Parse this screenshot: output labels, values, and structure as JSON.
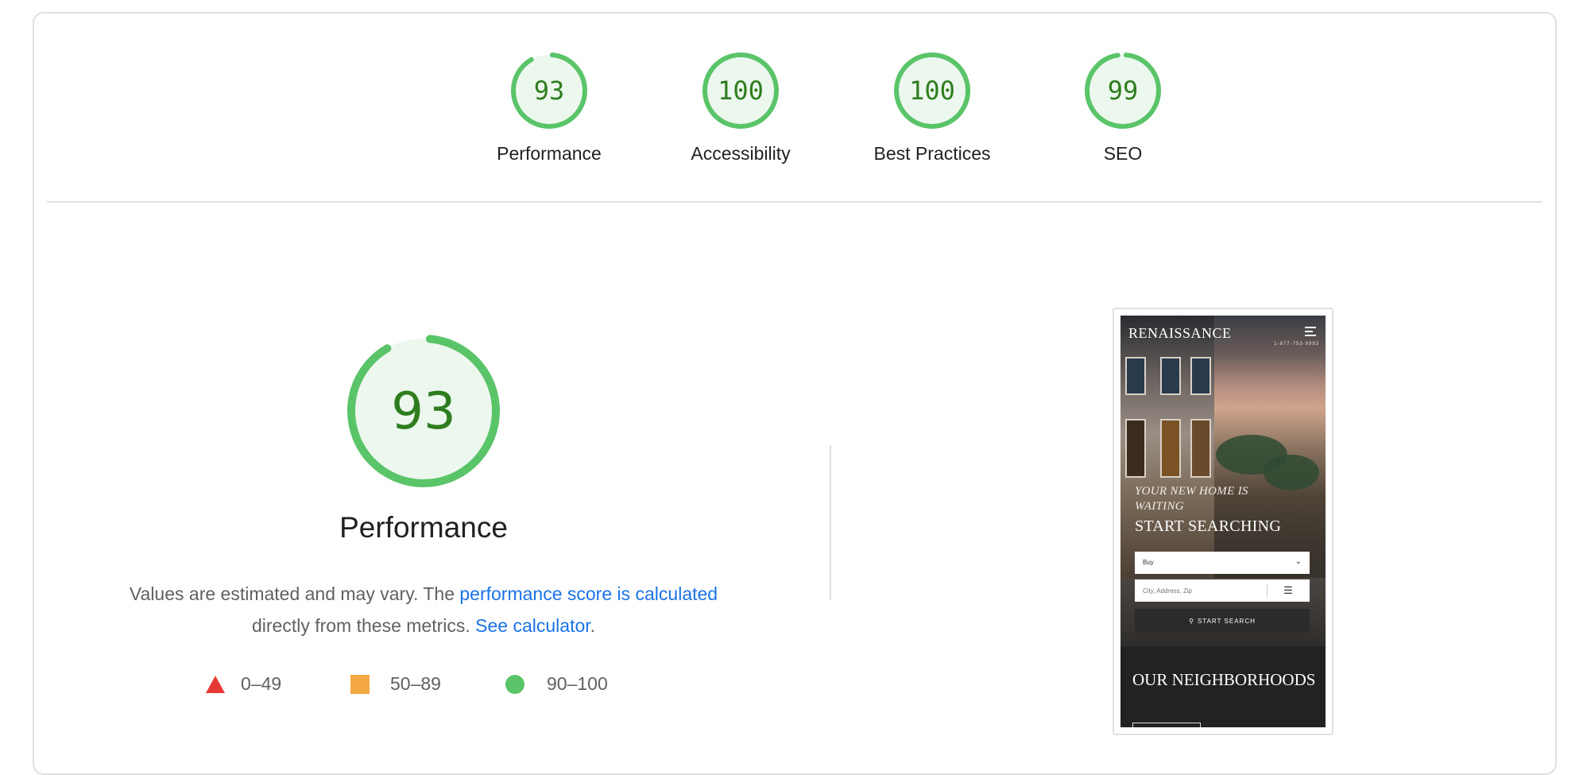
{
  "scores": [
    {
      "label": "Performance",
      "value": "93",
      "fraction": 0.93
    },
    {
      "label": "Accessibility",
      "value": "100",
      "fraction": 1.0
    },
    {
      "label": "Best Practices",
      "value": "100",
      "fraction": 1.0
    },
    {
      "label": "SEO",
      "value": "99",
      "fraction": 0.99
    }
  ],
  "performance": {
    "score": "93",
    "fraction": 0.93,
    "title": "Performance",
    "desc_prefix": "Values are estimated and may vary. The ",
    "desc_link": "performance score is calculated",
    "desc_middle": " directly from these metrics. ",
    "calc_link": "See calculator",
    "desc_suffix": "."
  },
  "legend": {
    "fail": "0–49",
    "average": "50–89",
    "pass": "90–100"
  },
  "colors": {
    "pass_ring": "#5ac469",
    "pass_text": "#2e7d1e",
    "pass_fill": "#ecf7ee",
    "average": "#f4a742",
    "fail": "#e53935",
    "link": "#1a73e8"
  },
  "screenshot": {
    "brand": "RENAISSANCE",
    "phone": "1-877-753-9993",
    "tagline": "YOUR NEW HOME IS WAITING",
    "heading": "START SEARCHING",
    "select_value": "Buy",
    "search_placeholder": "City, Address, Zip",
    "search_button": "START SEARCH",
    "neighborhoods": "OUR NEIGHBORHOODS"
  },
  "icons": {
    "menu": "hamburger-icon",
    "chevron": "chevron-down-icon",
    "filter": "sliders-icon",
    "search": "search-icon"
  }
}
